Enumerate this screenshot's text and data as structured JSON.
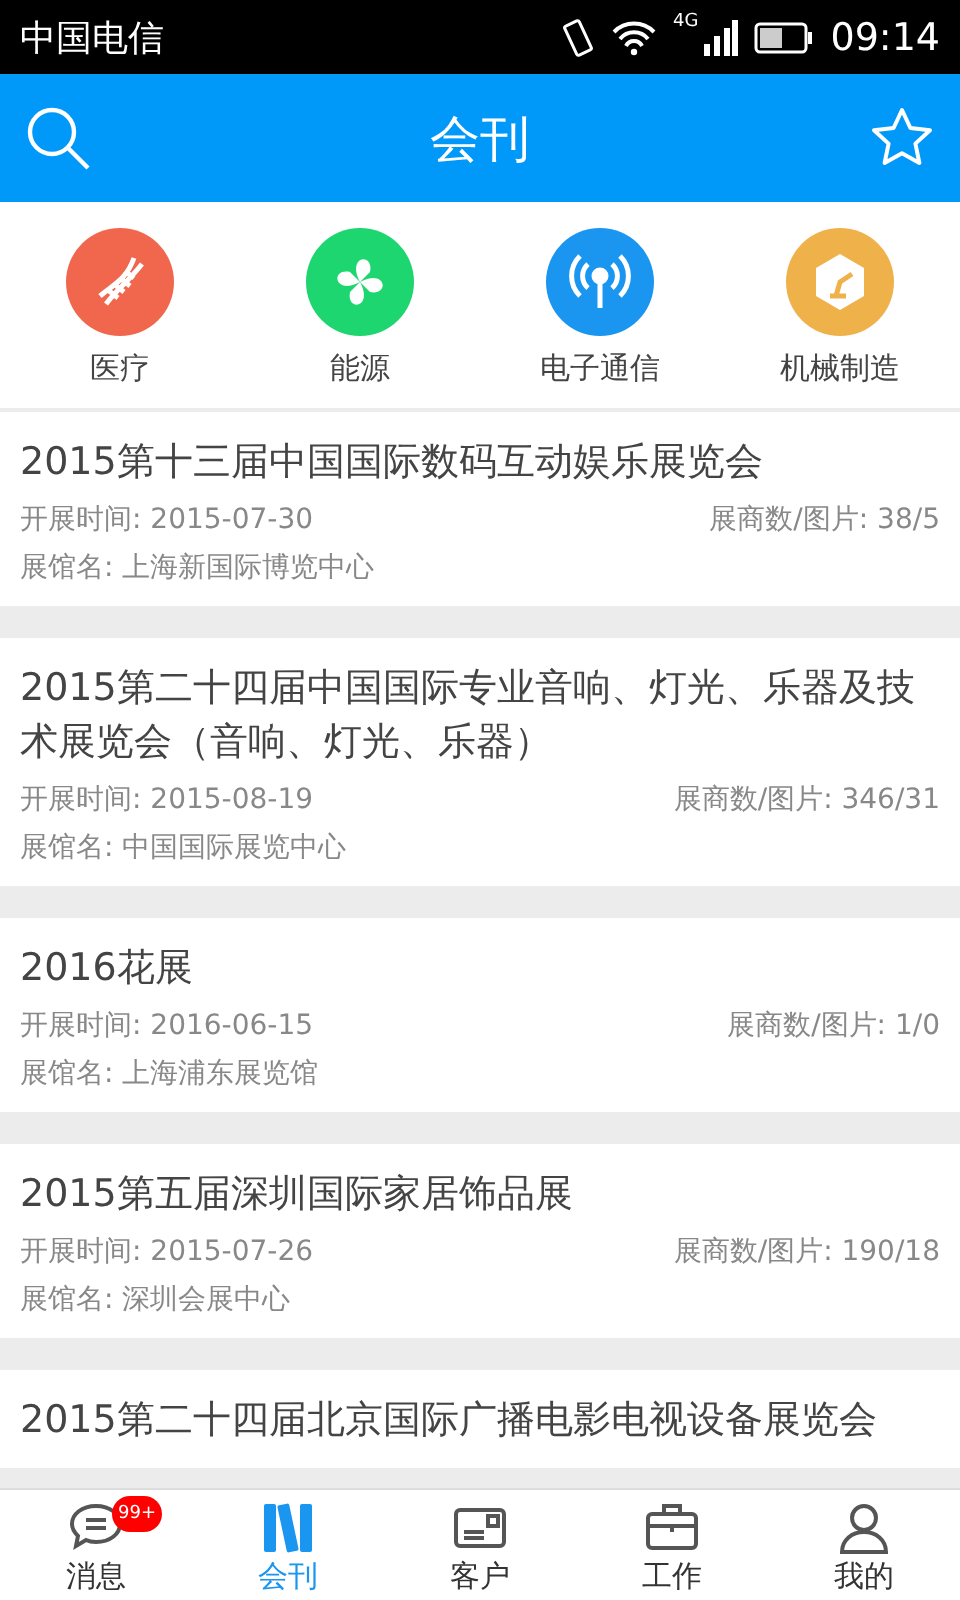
{
  "status_bar": {
    "carrier": "中国电信",
    "network": "4G",
    "time": "09:14"
  },
  "header": {
    "title": "会刊"
  },
  "categories": [
    {
      "kind": "dna",
      "label": "医疗",
      "color": "#f0674e"
    },
    {
      "kind": "fan",
      "label": "能源",
      "color": "#1ed66f"
    },
    {
      "kind": "antenna",
      "label": "电子通信",
      "color": "#1a96f0"
    },
    {
      "kind": "robot",
      "label": "机械制造",
      "color": "#efb24a"
    }
  ],
  "exhibitions": [
    {
      "title": "2015第十三届中国国际数码互动娱乐展览会",
      "date": "开展时间: 2015-07-30",
      "counts": "展商数/图片: 38/5",
      "venue": "展馆名: 上海新国际博览中心"
    },
    {
      "title": "2015第二十四届中国国际专业音响、灯光、乐器及技术展览会（音响、灯光、乐器）",
      "date": "开展时间: 2015-08-19",
      "counts": "展商数/图片: 346/31",
      "venue": "展馆名: 中国国际展览中心"
    },
    {
      "title": "2016花展",
      "date": "开展时间: 2016-06-15",
      "counts": "展商数/图片: 1/0",
      "venue": "展馆名: 上海浦东展览馆"
    },
    {
      "title": "2015第五届深圳国际家居饰品展",
      "date": "开展时间: 2015-07-26",
      "counts": "展商数/图片: 190/18",
      "venue": "展馆名: 深圳会展中心"
    },
    {
      "title": "2015第二十四届北京国际广播电影电视设备展览会"
    }
  ],
  "tab_bar": [
    {
      "kind": "chat",
      "label": "消息",
      "selected": false,
      "badge": "99+"
    },
    {
      "kind": "books",
      "label": "会刊",
      "selected": true
    },
    {
      "kind": "card",
      "label": "客户",
      "selected": false
    },
    {
      "kind": "briefcase",
      "label": "工作",
      "selected": false
    },
    {
      "kind": "person",
      "label": "我的",
      "selected": false
    }
  ]
}
